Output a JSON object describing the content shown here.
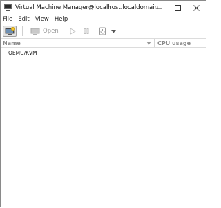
{
  "window": {
    "title": "Virtual Machine Manager@localhost.localdomain",
    "app_icon": "computer-monitor-icon",
    "controls": {
      "minimize": "—",
      "maximize": "☐",
      "close": "✕"
    }
  },
  "menubar": {
    "items": [
      {
        "label": "File"
      },
      {
        "label": "Edit"
      },
      {
        "label": "View"
      },
      {
        "label": "Help"
      }
    ]
  },
  "toolbar": {
    "new_vm_icon": "new-vm-icon",
    "open_label": "Open",
    "open_icon": "monitor-icon",
    "run_icon": "play-icon",
    "pause_icon": "pause-icon",
    "shutdown_icon": "power-icon",
    "menu_icon": "chevron-down-icon"
  },
  "columns": {
    "name": "Name",
    "cpu": "CPU usage",
    "sort_icon": "sort-down-icon"
  },
  "connections": [
    {
      "label": "QEMU/KVM"
    }
  ]
}
